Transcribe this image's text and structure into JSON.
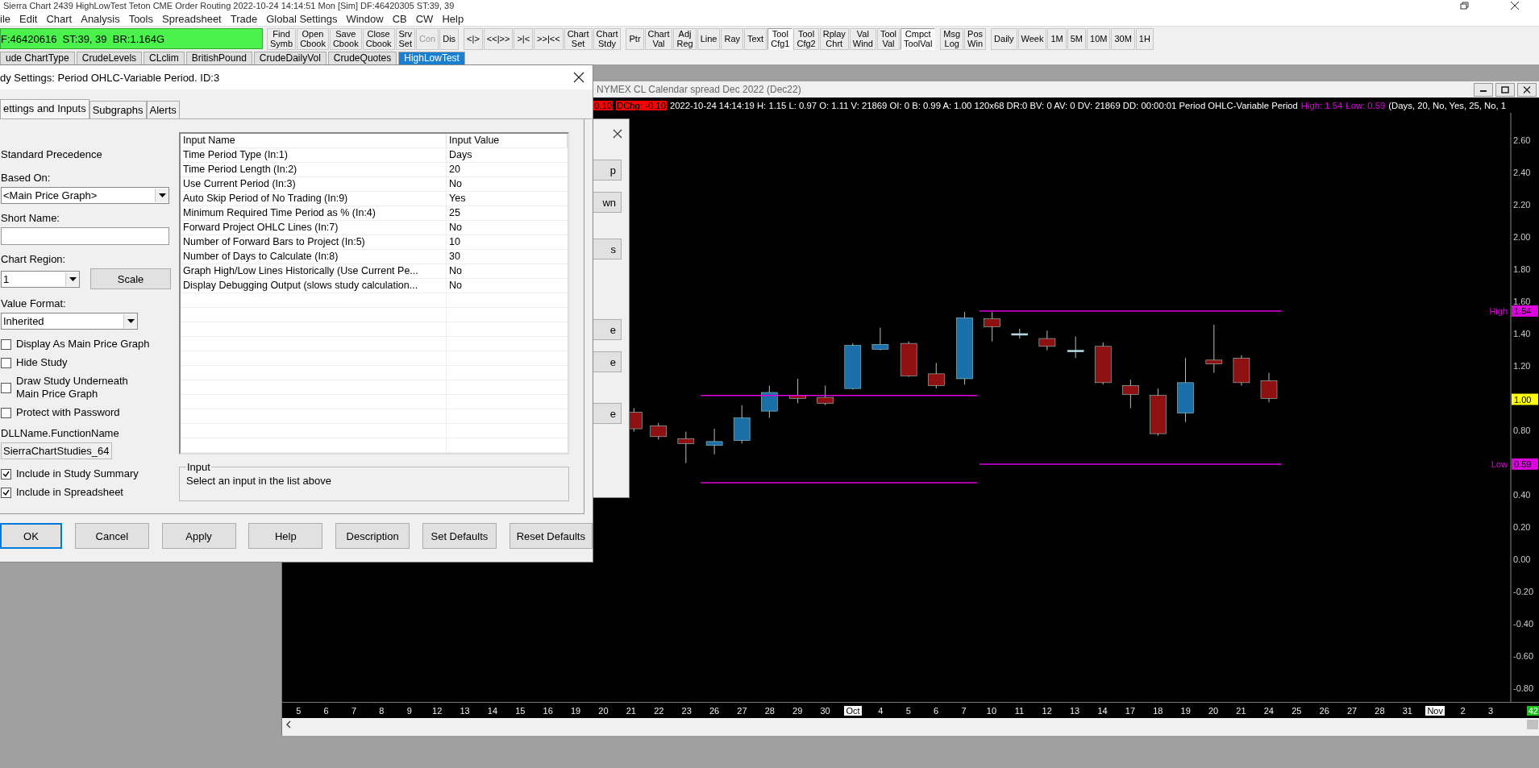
{
  "window": {
    "title": "Sierra Chart 2439 HighLowTest  Teton CME Order Routing 2022-10-24  14:14:51 Mon [Sim]  DF:46420305  ST:39, 39"
  },
  "menu": [
    "ile",
    "Edit",
    "Chart",
    "Analysis",
    "Tools",
    "Spreadsheet",
    "Trade",
    "Global Settings",
    "Window",
    "CB",
    "CW",
    "Help"
  ],
  "toolbar": {
    "status": "F:46420616  ST:39, 39  BR:1.164G",
    "buttons": [
      {
        "lines": [
          "Find",
          "Symb"
        ],
        "disabled": false,
        "pressed": false
      },
      {
        "lines": [
          "Open",
          "Cbook"
        ],
        "disabled": false,
        "pressed": false
      },
      {
        "lines": [
          "Save",
          "Cbook"
        ],
        "disabled": false,
        "pressed": false
      },
      {
        "lines": [
          "Close",
          "Cbook"
        ],
        "disabled": false,
        "pressed": false
      },
      {
        "lines": [
          "Srv",
          "Set"
        ],
        "disabled": false,
        "pressed": false
      },
      {
        "lines": [
          "Con"
        ],
        "disabled": true,
        "pressed": false
      },
      {
        "lines": [
          "Dis"
        ],
        "disabled": false,
        "pressed": false
      },
      {
        "lines": [
          "<|>"
        ],
        "disabled": false,
        "pressed": false
      },
      {
        "lines": [
          "<<|>>"
        ],
        "disabled": false,
        "pressed": false
      },
      {
        "lines": [
          ">|<"
        ],
        "disabled": false,
        "pressed": false
      },
      {
        "lines": [
          ">>|<<"
        ],
        "disabled": false,
        "pressed": false
      },
      {
        "lines": [
          "Chart",
          "Set"
        ],
        "disabled": false,
        "pressed": false
      },
      {
        "lines": [
          "Chart",
          "Stdy"
        ],
        "disabled": false,
        "pressed": false
      },
      {
        "lines": [
          "Ptr"
        ],
        "disabled": false,
        "pressed": false
      },
      {
        "lines": [
          "Chart",
          "Val"
        ],
        "disabled": false,
        "pressed": false
      },
      {
        "lines": [
          "Adj",
          "Reg"
        ],
        "disabled": false,
        "pressed": false
      },
      {
        "lines": [
          "Line"
        ],
        "disabled": false,
        "pressed": false
      },
      {
        "lines": [
          "Ray"
        ],
        "disabled": false,
        "pressed": false
      },
      {
        "lines": [
          "Text"
        ],
        "disabled": false,
        "pressed": false
      },
      {
        "lines": [
          "Tool",
          "Cfg1"
        ],
        "disabled": false,
        "pressed": true
      },
      {
        "lines": [
          "Tool",
          "Cfg2"
        ],
        "disabled": false,
        "pressed": false
      },
      {
        "lines": [
          "Rplay",
          "Chrt"
        ],
        "disabled": false,
        "pressed": false
      },
      {
        "lines": [
          "Val",
          "Wind"
        ],
        "disabled": false,
        "pressed": false
      },
      {
        "lines": [
          "Tool",
          "Val"
        ],
        "disabled": false,
        "pressed": false
      },
      {
        "lines": [
          "Cmpct",
          "ToolVal"
        ],
        "disabled": false,
        "pressed": true
      },
      {
        "lines": [
          "Msg",
          "Log"
        ],
        "disabled": false,
        "pressed": false
      },
      {
        "lines": [
          "Pos",
          "Win"
        ],
        "disabled": false,
        "pressed": false
      },
      {
        "lines": [
          "Daily"
        ],
        "disabled": false,
        "pressed": false
      },
      {
        "lines": [
          "Week"
        ],
        "disabled": false,
        "pressed": false
      },
      {
        "lines": [
          "1M"
        ],
        "disabled": false,
        "pressed": false
      },
      {
        "lines": [
          "5M"
        ],
        "disabled": false,
        "pressed": false
      },
      {
        "lines": [
          "10M"
        ],
        "disabled": false,
        "pressed": false
      },
      {
        "lines": [
          "30M"
        ],
        "disabled": false,
        "pressed": false
      },
      {
        "lines": [
          "1H"
        ],
        "disabled": false,
        "pressed": false
      }
    ]
  },
  "chartbook_tabs": [
    {
      "label": "ude ChartType",
      "selected": false
    },
    {
      "label": "CrudeLevels",
      "selected": false
    },
    {
      "label": "CLclim",
      "selected": false
    },
    {
      "label": "BritishPound",
      "selected": false
    },
    {
      "label": "CrudeDailyVol",
      "selected": false
    },
    {
      "label": "CrudeQuotes",
      "selected": false
    },
    {
      "label": "HighLowTest",
      "selected": true
    }
  ],
  "back_panel": {
    "buttons": [
      "p",
      "wn",
      "s",
      "e",
      "e",
      "e"
    ]
  },
  "chart": {
    "title": "NYMEX CL Calendar spread Dec 2022 (Dec22)",
    "info": {
      "last": "0.10",
      "change": "DChg: -0.10",
      "text": "2022-10-24 14:14:19 H: 1.15 L: 0.97 O: 1.11 V: 21869 OI: 0 B: 0.99 A: 1.00 120x68 DR:0 BV: 0 AV: 0 DV: 21869 DD: 00:00:01 Period OHLC-Variable Period",
      "high": "High: 1.54",
      "low": "Low: 0.59",
      "params": "(Days, 20, No, Yes, 25, No, 1"
    },
    "price_axis": [
      "2.60",
      "2.40",
      "2.20",
      "2.00",
      "1.80",
      "1.60",
      "1.40",
      "1.20",
      "0.80",
      "0.40",
      "0.20",
      "0.00",
      "-0.20",
      "-0.40",
      "-0.60",
      "-0.80"
    ],
    "markers": [
      {
        "kind": "high",
        "label": "High",
        "value": "1.54"
      },
      {
        "kind": "last",
        "value": "1.00"
      },
      {
        "kind": "low",
        "label": "Low",
        "value": "0.59"
      }
    ],
    "date_axis": [
      {
        "label": "5",
        "month": false
      },
      {
        "label": "6",
        "month": false
      },
      {
        "label": "7",
        "month": false
      },
      {
        "label": "8",
        "month": false
      },
      {
        "label": "9",
        "month": false
      },
      {
        "label": "12",
        "month": false
      },
      {
        "label": "13",
        "month": false
      },
      {
        "label": "14",
        "month": false
      },
      {
        "label": "15",
        "month": false
      },
      {
        "label": "16",
        "month": false
      },
      {
        "label": "19",
        "month": false
      },
      {
        "label": "20",
        "month": false
      },
      {
        "label": "21",
        "month": false
      },
      {
        "label": "22",
        "month": false
      },
      {
        "label": "23",
        "month": false
      },
      {
        "label": "26",
        "month": false
      },
      {
        "label": "27",
        "month": false
      },
      {
        "label": "28",
        "month": false
      },
      {
        "label": "29",
        "month": false
      },
      {
        "label": "30",
        "month": false
      },
      {
        "label": "Oct",
        "month": true
      },
      {
        "label": "4",
        "month": false
      },
      {
        "label": "5",
        "month": false
      },
      {
        "label": "6",
        "month": false
      },
      {
        "label": "7",
        "month": false
      },
      {
        "label": "10",
        "month": false
      },
      {
        "label": "11",
        "month": false
      },
      {
        "label": "12",
        "month": false
      },
      {
        "label": "13",
        "month": false
      },
      {
        "label": "14",
        "month": false
      },
      {
        "label": "17",
        "month": false
      },
      {
        "label": "18",
        "month": false
      },
      {
        "label": "19",
        "month": false
      },
      {
        "label": "20",
        "month": false
      },
      {
        "label": "21",
        "month": false
      },
      {
        "label": "24",
        "month": false
      },
      {
        "label": "25",
        "month": false
      },
      {
        "label": "26",
        "month": false
      },
      {
        "label": "27",
        "month": false
      },
      {
        "label": "28",
        "month": false
      },
      {
        "label": "31",
        "month": false
      },
      {
        "label": "Nov",
        "month": true
      },
      {
        "label": "2",
        "month": false
      },
      {
        "label": "3",
        "month": false
      }
    ],
    "corner": "42"
  },
  "dialog": {
    "title": "dy Settings: Period OHLC-Variable Period. ID:3",
    "tabs": [
      {
        "label": "ettings and Inputs",
        "selected": true
      },
      {
        "label": "Subgraphs",
        "selected": false
      },
      {
        "label": "Alerts",
        "selected": false
      }
    ],
    "precedence": "Standard Precedence",
    "based_on": {
      "label": "Based On:",
      "value": "<Main Price Graph>"
    },
    "short_name": {
      "label": "Short Name:"
    },
    "chart_region": {
      "label": "Chart Region:",
      "value": "1",
      "button": "Scale"
    },
    "value_format": {
      "label": "Value Format:",
      "value": "Inherited"
    },
    "options": [
      {
        "label": "Display As Main Price Graph",
        "checked": false
      },
      {
        "label": "Hide Study",
        "checked": false
      },
      {
        "label": "Draw Study Underneath\nMain Price Graph",
        "checked": false
      },
      {
        "label": "Protect with Password",
        "checked": false
      }
    ],
    "dll": {
      "label": "DLLName.FunctionName",
      "value": "SierraChartStudies_64"
    },
    "options2": [
      {
        "label": "Include in Study Summary",
        "checked": true
      },
      {
        "label": "Include in Spreadsheet",
        "checked": true
      }
    ],
    "grid": {
      "columns": [
        "Input Name",
        "Input Value"
      ],
      "rows": [
        {
          "name": "Time Period Type   (In:1)",
          "value": "Days"
        },
        {
          "name": "Time Period Length   (In:2)",
          "value": "20"
        },
        {
          "name": "Use Current Period   (In:3)",
          "value": "No"
        },
        {
          "name": "Auto Skip Period of No Trading   (In:9)",
          "value": "Yes"
        },
        {
          "name": "Minimum Required Time Period as %   (In:4)",
          "value": "25"
        },
        {
          "name": "Forward Project OHLC Lines   (In:7)",
          "value": "No"
        },
        {
          "name": "Number of Forward Bars to Project   (In:5)",
          "value": "10"
        },
        {
          "name": "Number of Days to Calculate   (In:8)",
          "value": "30"
        },
        {
          "name": "Graph High/Low Lines Historically (Use Current Pe...",
          "value": "No"
        },
        {
          "name": "Display Debugging Output (slows study calculation...",
          "value": "No"
        }
      ]
    },
    "input_box": {
      "legend": "Input",
      "text": "Select an input in the list above"
    },
    "buttons": [
      {
        "label": "OK",
        "default": true
      },
      {
        "label": "Cancel",
        "default": false
      },
      {
        "label": "Apply",
        "default": false
      },
      {
        "label": "Help",
        "default": false
      },
      {
        "label": "Description",
        "default": false
      },
      {
        "label": "Set Defaults",
        "default": false
      },
      {
        "label": "Reset Defaults",
        "default": false
      }
    ]
  }
}
